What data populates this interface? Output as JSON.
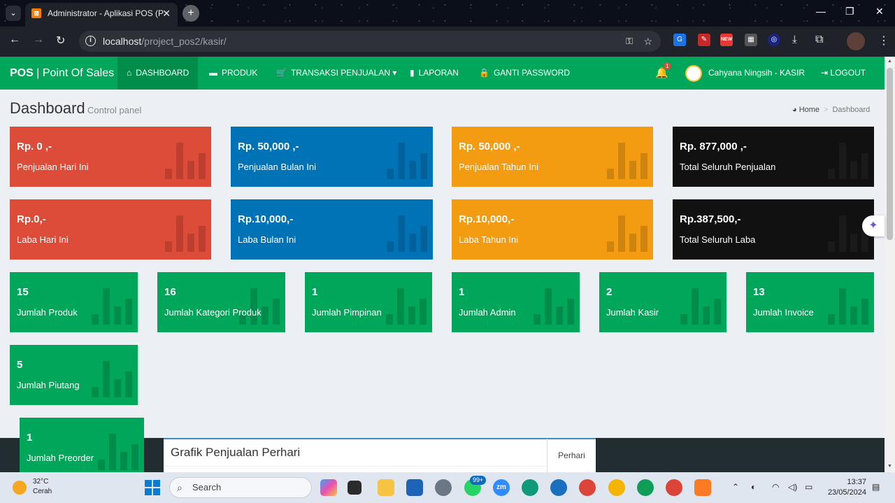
{
  "browser": {
    "tab_title": "Administrator - Aplikasi POS (P",
    "favicon_glyph": "⊠",
    "url_host": "localhost",
    "url_path": "/project_pos2/kasir/",
    "ext_new_badge": "NEW"
  },
  "navbar": {
    "brand_bold": "POS",
    "brand_rest": " | Point Of Sales",
    "menu": [
      {
        "label": "DASHBOARD",
        "icon": "home-icon"
      },
      {
        "label": "PRODUK",
        "icon": "folder-icon"
      },
      {
        "label": "TRANSAKSI PENJUALAN",
        "icon": "cart-icon"
      },
      {
        "label": "LAPORAN",
        "icon": "file-icon"
      },
      {
        "label": "GANTI PASSWORD",
        "icon": "lock-icon"
      }
    ],
    "notification_count": "1",
    "user_name": "Cahyana Ningsih - KASIR",
    "logout_label": "LOGOUT"
  },
  "header": {
    "title": "Dashboard",
    "subtitle": "Control panel",
    "breadcrumb_home": "Home",
    "breadcrumb_current": "Dashboard"
  },
  "stats_sales": [
    {
      "value": "Rp. 0 ,-",
      "label": "Penjualan Hari Ini",
      "color": "#dd4b39"
    },
    {
      "value": "Rp. 50,000 ,-",
      "label": "Penjualan Bulan Ini",
      "color": "#0073b7"
    },
    {
      "value": "Rp. 50,000 ,-",
      "label": "Penjualan Tahun Ini",
      "color": "#f39c12"
    },
    {
      "value": "Rp. 877,000 ,-",
      "label": "Total Seluruh Penjualan",
      "color": "#111111"
    }
  ],
  "stats_profit": [
    {
      "value": "Rp.0,-",
      "label": "Laba Hari Ini",
      "color": "#dd4b39"
    },
    {
      "value": "Rp.10,000,-",
      "label": "Laba Bulan Ini",
      "color": "#0073b7"
    },
    {
      "value": "Rp.10,000,-",
      "label": "Laba Tahun Ini",
      "color": "#f39c12"
    },
    {
      "value": "Rp.387,500,-",
      "label": "Total Seluruh Laba",
      "color": "#111111"
    }
  ],
  "stats_counts": [
    {
      "value": "15",
      "label": "Jumlah Produk"
    },
    {
      "value": "16",
      "label": "Jumlah Kategori Produk"
    },
    {
      "value": "1",
      "label": "Jumlah Pimpinan"
    },
    {
      "value": "1",
      "label": "Jumlah Admin"
    },
    {
      "value": "2",
      "label": "Jumlah Kasir"
    },
    {
      "value": "13",
      "label": "Jumlah Invoice"
    }
  ],
  "stat_piutang": {
    "value": "5",
    "label": "Jumlah Piutang"
  },
  "stat_preorder": {
    "value": "1",
    "label": "Jumlah Preorder"
  },
  "chart_panel": {
    "title": "Grafik Penjualan Perhari",
    "tab": "Perhari"
  },
  "taskbar": {
    "temperature": "32°C",
    "condition": "Cerah",
    "search_placeholder": "Search",
    "whatsapp_badge": "99+",
    "zoom_label": "zm",
    "time": "13:37",
    "date": "23/05/2024"
  },
  "colors": {
    "green": "#00a65a",
    "green_dark": "#008d4c",
    "red": "#dd4b39",
    "blue": "#0073b7",
    "orange": "#f39c12",
    "black": "#111111"
  }
}
